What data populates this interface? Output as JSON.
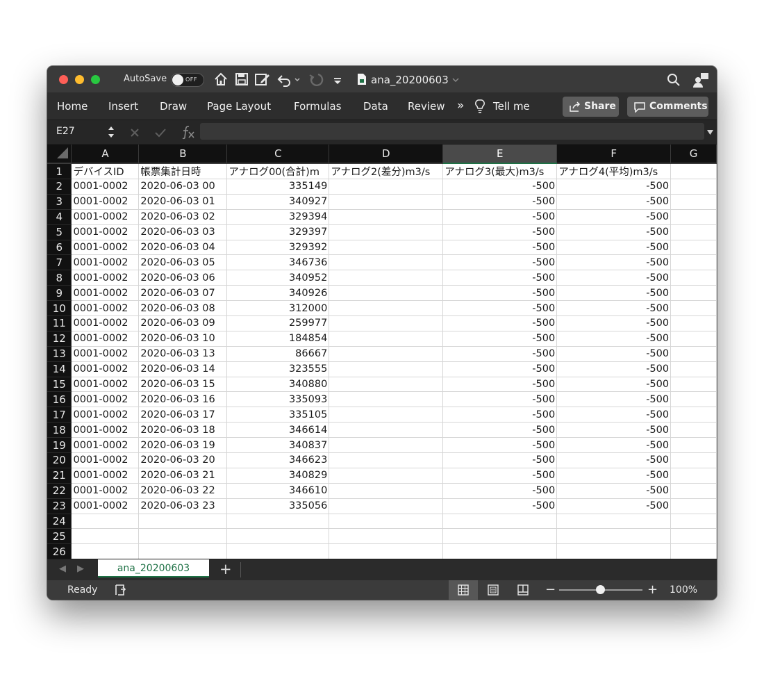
{
  "titlebar": {
    "autosave_label": "AutoSave",
    "autosave_state": "OFF",
    "document_title": "ana_20200603",
    "icons": [
      "home-icon",
      "save-icon",
      "save-as-icon",
      "undo-icon",
      "redo-icon",
      "customize-toolbar-icon",
      "search-icon",
      "share-person-icon"
    ]
  },
  "ribbon": {
    "tabs": [
      "Home",
      "Insert",
      "Draw",
      "Page Layout",
      "Formulas",
      "Data",
      "Review"
    ],
    "more": "»",
    "tell_me": "Tell me",
    "share_label": "Share",
    "comments_label": "Comments"
  },
  "formula_bar": {
    "name_box": "E27",
    "formula": ""
  },
  "sheet": {
    "columns": [
      "A",
      "B",
      "C",
      "D",
      "E",
      "F",
      "G"
    ],
    "selected_column": "E",
    "header_row": [
      "デバイスID",
      "帳票集計日時",
      "アナログ00(合計)m",
      "アナログ2(差分)m3/s",
      "アナログ3(最大)m3/s",
      "アナログ4(平均)m3/s",
      ""
    ],
    "rows": [
      [
        "0001-0002",
        "2020-06-03 00",
        "335149",
        "",
        "-500",
        "-500",
        ""
      ],
      [
        "0001-0002",
        "2020-06-03 01",
        "340927",
        "",
        "-500",
        "-500",
        ""
      ],
      [
        "0001-0002",
        "2020-06-03 02",
        "329394",
        "",
        "-500",
        "-500",
        ""
      ],
      [
        "0001-0002",
        "2020-06-03 03",
        "329397",
        "",
        "-500",
        "-500",
        ""
      ],
      [
        "0001-0002",
        "2020-06-03 04",
        "329392",
        "",
        "-500",
        "-500",
        ""
      ],
      [
        "0001-0002",
        "2020-06-03 05",
        "346736",
        "",
        "-500",
        "-500",
        ""
      ],
      [
        "0001-0002",
        "2020-06-03 06",
        "340952",
        "",
        "-500",
        "-500",
        ""
      ],
      [
        "0001-0002",
        "2020-06-03 07",
        "340926",
        "",
        "-500",
        "-500",
        ""
      ],
      [
        "0001-0002",
        "2020-06-03 08",
        "312000",
        "",
        "-500",
        "-500",
        ""
      ],
      [
        "0001-0002",
        "2020-06-03 09",
        "259977",
        "",
        "-500",
        "-500",
        ""
      ],
      [
        "0001-0002",
        "2020-06-03 10",
        "184854",
        "",
        "-500",
        "-500",
        ""
      ],
      [
        "0001-0002",
        "2020-06-03 13",
        "86667",
        "",
        "-500",
        "-500",
        ""
      ],
      [
        "0001-0002",
        "2020-06-03 14",
        "323555",
        "",
        "-500",
        "-500",
        ""
      ],
      [
        "0001-0002",
        "2020-06-03 15",
        "340880",
        "",
        "-500",
        "-500",
        ""
      ],
      [
        "0001-0002",
        "2020-06-03 16",
        "335093",
        "",
        "-500",
        "-500",
        ""
      ],
      [
        "0001-0002",
        "2020-06-03 17",
        "335105",
        "",
        "-500",
        "-500",
        ""
      ],
      [
        "0001-0002",
        "2020-06-03 18",
        "346614",
        "",
        "-500",
        "-500",
        ""
      ],
      [
        "0001-0002",
        "2020-06-03 19",
        "340837",
        "",
        "-500",
        "-500",
        ""
      ],
      [
        "0001-0002",
        "2020-06-03 20",
        "346623",
        "",
        "-500",
        "-500",
        ""
      ],
      [
        "0001-0002",
        "2020-06-03 21",
        "340829",
        "",
        "-500",
        "-500",
        ""
      ],
      [
        "0001-0002",
        "2020-06-03 22",
        "346610",
        "",
        "-500",
        "-500",
        ""
      ],
      [
        "0001-0002",
        "2020-06-03 23",
        "335056",
        "",
        "-500",
        "-500",
        ""
      ],
      [
        "",
        "",
        "",
        "",
        "",
        "",
        ""
      ],
      [
        "",
        "",
        "",
        "",
        "",
        "",
        ""
      ],
      [
        "",
        "",
        "",
        "",
        "",
        "",
        ""
      ]
    ],
    "row_numbers": [
      "1",
      "2",
      "3",
      "4",
      "5",
      "6",
      "7",
      "8",
      "9",
      "10",
      "11",
      "12",
      "13",
      "14",
      "15",
      "16",
      "17",
      "18",
      "19",
      "20",
      "21",
      "22",
      "23",
      "24",
      "25",
      "26"
    ],
    "numeric_columns": [
      2,
      4,
      5
    ]
  },
  "sheet_tabs": {
    "tabs": [
      "ana_20200603"
    ],
    "add_label": "+"
  },
  "statusbar": {
    "status": "Ready",
    "zoom_minus": "−",
    "zoom_plus": "+",
    "zoom_percent": "100%",
    "zoom_level": 1.0
  },
  "colors": {
    "accent": "#1e7145",
    "chrome": "#2d2d2d",
    "header_bg": "#111111"
  }
}
